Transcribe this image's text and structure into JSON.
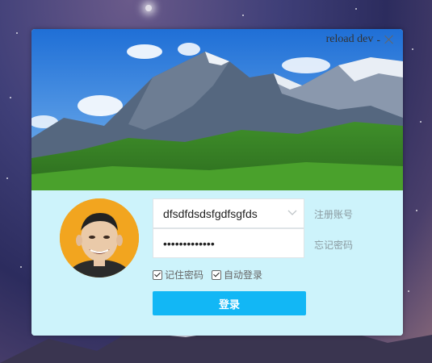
{
  "window": {
    "title": "reload dev",
    "minimize": "-"
  },
  "login": {
    "username": "dfsdfdsdsfgdfsgfds",
    "password": "•••••••••••••",
    "register_link": "注册账号",
    "forgot_link": "忘记密码",
    "remember_password": "记住密码",
    "remember_password_checked": true,
    "auto_login": "自动登录",
    "auto_login_checked": true,
    "submit_label": "登录"
  },
  "colors": {
    "panel_bg": "#cdf3fb",
    "button_bg": "#12b7f5",
    "button_text": "#ffffff",
    "link": "#8a9aa0"
  },
  "icons": {
    "dropdown": "chevron-down-icon",
    "close": "close-icon"
  }
}
